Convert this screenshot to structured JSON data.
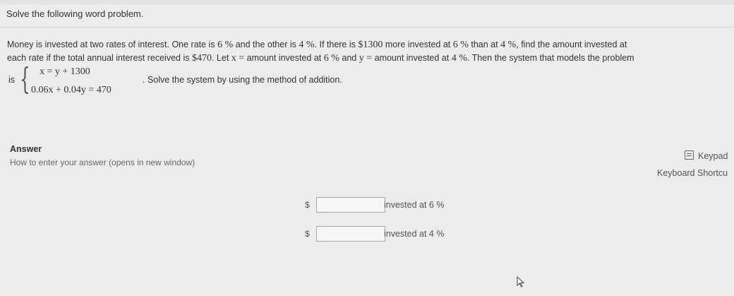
{
  "header": {
    "title": "Solve the following word problem."
  },
  "problem": {
    "line1_a": "Money is invested at two rates of interest.  One rate is ",
    "rate1": "6 %",
    "line1_b": " and the other is ",
    "rate2": "4 %",
    "line1_c": ".  If there is ",
    "more_amount": "$1300",
    "line1_d": " more invested at ",
    "rate1_again": "6 %",
    "line1_e": " than at ",
    "rate2_again": "4 %",
    "line1_f": ", find the amount invested at",
    "line2_a": "each rate if the total annual interest received is ",
    "total": "$470",
    "line2_b": ".  Let ",
    "let_x": "x =",
    "line2_c": " amount invested at ",
    "rate1_third": "6 %",
    "line2_d": " and ",
    "let_y": "y =",
    "line2_e": " amount invested at ",
    "rate2_third": "4 %",
    "line2_f": ".  Then the system that models the problem"
  },
  "system": {
    "is_label": "is",
    "eq1": "x = y + 1300",
    "eq2": "0.06x + 0.04y = 470",
    "followup": ". Solve the system by using the method of addition."
  },
  "answer": {
    "label": "Answer",
    "howto": "How to enter your answer (opens in new window)",
    "keypad": "Keypad",
    "shortcuts": "Keyboard Shortcu",
    "rows": [
      {
        "currency": "$",
        "value": "",
        "suffix": "invested at 6 %"
      },
      {
        "currency": "$",
        "value": "",
        "suffix": "invested at 4 %"
      }
    ]
  }
}
